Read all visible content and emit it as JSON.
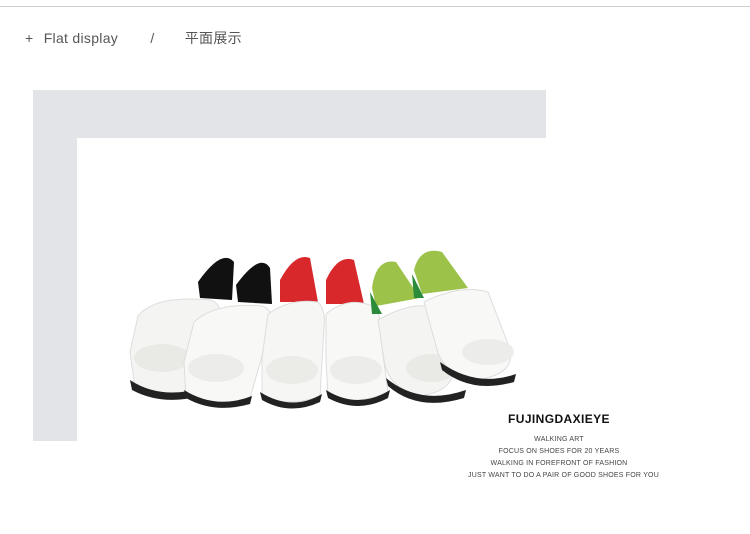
{
  "header": {
    "plus": "+",
    "title_en": "Flat display",
    "separator": "/",
    "title_cn": "平面展示"
  },
  "brand": {
    "name": "FUJINGDAXIEYE",
    "lines": [
      "WALKING ART",
      "FOCUS ON SHOES FOR 20 YEARS",
      "WALKING IN FOREFRONT OF FASHION",
      "JUST WANT TO DO A PAIR OF GOOD SHOES FOR YOU"
    ]
  },
  "product": {
    "image": "six white peep-toe slip-on shoes in pairs with black, red and green linings",
    "lining_colors": [
      "#111111",
      "#d8282c",
      "#9cc24a"
    ],
    "upper_color": "#f4f4f2",
    "sole_color": "#222222"
  },
  "colors": {
    "frame": "#e3e4e8",
    "text": "#555555"
  }
}
